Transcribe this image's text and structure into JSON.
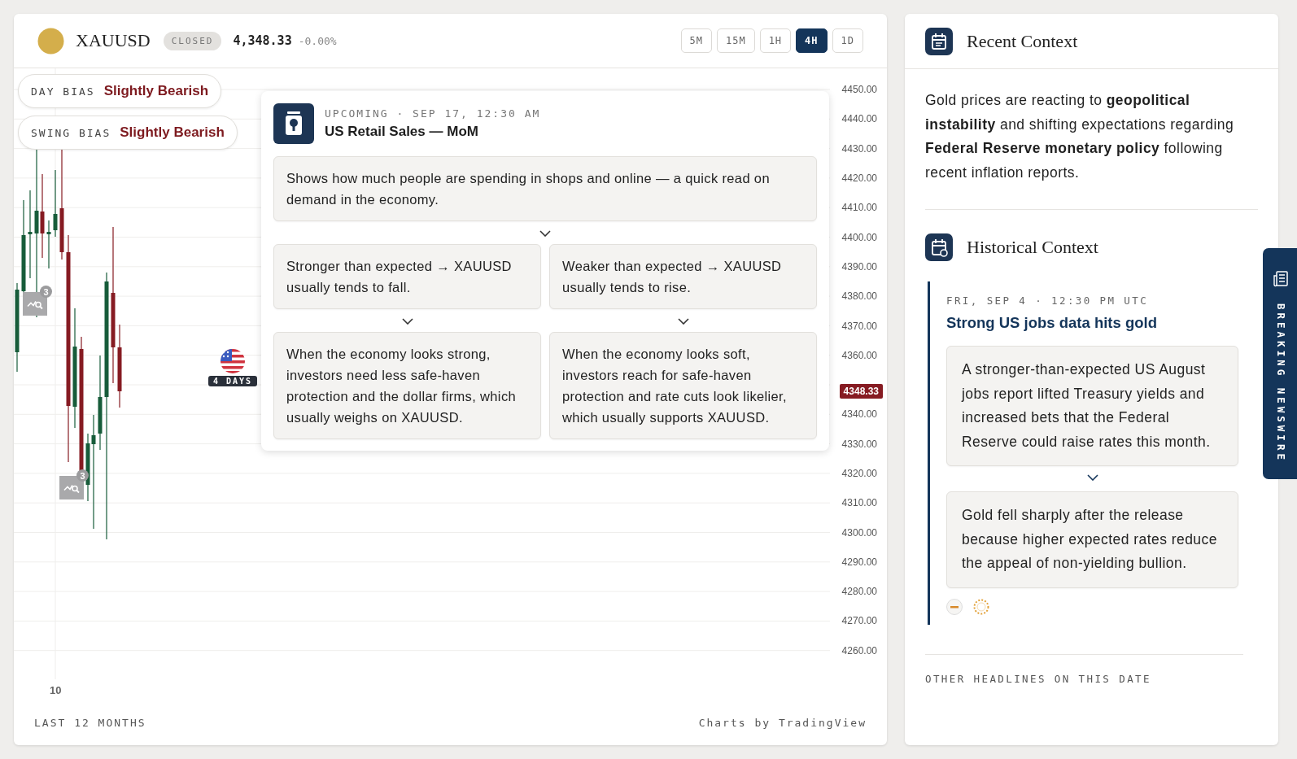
{
  "instrument": {
    "symbol": "XAUUSD",
    "status": "CLOSED",
    "price": "4,348.33",
    "change": "-0.00%"
  },
  "timeframes": [
    {
      "label": "5M",
      "selected": false
    },
    {
      "label": "15M",
      "selected": false
    },
    {
      "label": "1H",
      "selected": false
    },
    {
      "label": "4H",
      "selected": true
    },
    {
      "label": "1D",
      "selected": false
    }
  ],
  "bias": [
    {
      "label": "DAY BIAS",
      "value": "Slightly Bearish"
    },
    {
      "label": "SWING BIAS",
      "value": "Slightly Bearish"
    }
  ],
  "chart": {
    "y_axis": [
      {
        "text": "4450.00",
        "kind": "tick"
      },
      {
        "text": "4440.00",
        "kind": "tick"
      },
      {
        "text": "4430.00",
        "kind": "tick"
      },
      {
        "text": "4420.00",
        "kind": "tick"
      },
      {
        "text": "4410.00",
        "kind": "tick"
      },
      {
        "text": "4400.00",
        "kind": "tick"
      },
      {
        "text": "4390.00",
        "kind": "tick"
      },
      {
        "text": "4380.00",
        "kind": "tick"
      },
      {
        "text": "4370.00",
        "kind": "tick"
      },
      {
        "text": "4360.00",
        "kind": "tick"
      },
      {
        "text": "4348.33",
        "kind": "current"
      },
      {
        "text": "4340.00",
        "kind": "tick"
      },
      {
        "text": "4330.00",
        "kind": "tick"
      },
      {
        "text": "4320.00",
        "kind": "tick"
      },
      {
        "text": "4310.00",
        "kind": "tick"
      },
      {
        "text": "4300.00",
        "kind": "tick"
      },
      {
        "text": "4290.00",
        "kind": "tick"
      },
      {
        "text": "4280.00",
        "kind": "tick"
      },
      {
        "text": "4270.00",
        "kind": "tick"
      },
      {
        "text": "4260.00",
        "kind": "tick"
      }
    ],
    "x_axis": [
      "10"
    ],
    "markers": [
      {
        "count": "3"
      },
      {
        "count": "3"
      }
    ],
    "event_marker": {
      "countdown": "4 DAYS"
    }
  },
  "event_card": {
    "eyebrow": "UPCOMING · SEP 17, 12:30 AM",
    "title": "US Retail Sales — MoM",
    "summary": "Shows how much people are spending in shops and online — a quick read on demand in the economy.",
    "scenarios": [
      {
        "condition": "Stronger than expected → XAUUSD usually tends to fall.",
        "explanation": "When the economy looks strong, investors need less safe-haven protection and the dollar firms, which usually weighs on XAUUSD."
      },
      {
        "condition": "Weaker than expected → XAUUSD usually tends to rise.",
        "explanation": "When the economy looks soft, investors reach for safe-haven protection and rate cuts look likelier, which usually supports XAUUSD."
      }
    ]
  },
  "footer": {
    "range": "LAST 12 MONTHS",
    "credit": "Charts by TradingView"
  },
  "recent_context": {
    "title": "Recent Context",
    "body": "Gold prices are reacting to **geopolitical instability** and shifting expectations regarding **Federal Reserve monetary policy** following recent inflation reports."
  },
  "historical_context": {
    "title": "Historical Context",
    "items": [
      {
        "date": "FRI, SEP 4 · 12:30 PM UTC",
        "headline": "Strong US jobs data hits gold",
        "cause": "A stronger-than-expected US August jobs report lifted Treasury yields and increased bets that the Federal Reserve could raise rates this month.",
        "effect": "Gold fell sharply after the release because higher expected rates reduce the appeal of non-yielding bullion."
      }
    ]
  },
  "other_headlines": {
    "title": "OTHER HEADLINES ON THIS DATE"
  },
  "newswire_tab": {
    "label": "BREAKING NEWSWIRE"
  }
}
